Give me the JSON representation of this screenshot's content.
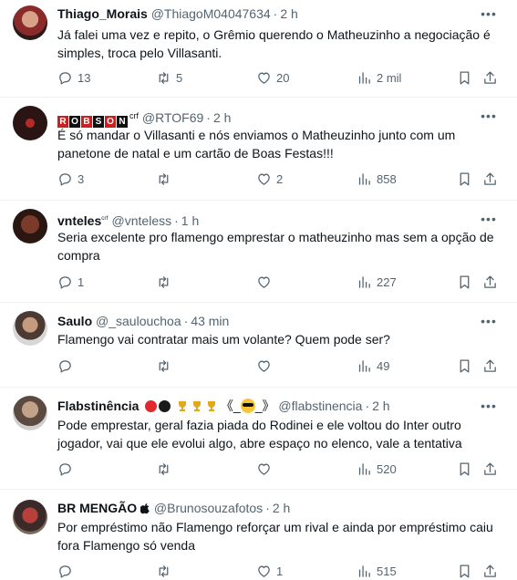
{
  "colors": {
    "text": "#0f1419",
    "muted": "#536471",
    "divider": "#eff3f4"
  },
  "tweets": [
    {
      "name": "Thiago_Morais",
      "handle": "@ThiagoM04047634",
      "time": "2 h",
      "text": "Já falei uma vez e repito, o Grêmio querendo o Matheuzinho a negociação é simples, troca pelo Villasanti.",
      "replies": "13",
      "retweets": "5",
      "likes": "20",
      "views": "2 mil"
    },
    {
      "name_letters": [
        "R",
        "O",
        "B",
        "S",
        "O",
        "N"
      ],
      "name_suffix": "crf",
      "handle": "@RTOF69",
      "time": "2 h",
      "text": "É só mandar o Villasanti e nós enviamos o Matheuzinho junto com um panetone de natal e um cartão de Boas Festas!!!",
      "replies": "3",
      "retweets": "",
      "likes": "2",
      "views": "858"
    },
    {
      "name": "vnteles",
      "name_suffix": "ᶜʳᶠ",
      "handle": "@vnteless",
      "time": "1 h",
      "text": "Seria excelente pro flamengo emprestar o matheuzinho mas sem a opção de compra",
      "replies": "1",
      "retweets": "",
      "likes": "",
      "views": "227"
    },
    {
      "name": "Saulo",
      "handle": "@_saulouchoa",
      "time": "43 min",
      "text": "Flamengo vai contratar mais um volante? Quem pode ser?",
      "replies": "",
      "retweets": "",
      "likes": "",
      "views": "49"
    },
    {
      "name": "Flabstinência",
      "name_extra": "《_",
      "name_extra2": "_》",
      "handle": "@flabstinencia",
      "time": "2 h",
      "text": "Pode emprestar, geral fazia piada do Rodinei e ele voltou do Inter outro jogador, vai que ele evolui algo, abre espaço no elenco, vale a tentativa",
      "replies": "",
      "retweets": "",
      "likes": "",
      "views": "520"
    },
    {
      "name": "BR MENGÃO",
      "handle": "@Brunosouzafotos",
      "time": "2 h",
      "text": "Por empréstimo não Flamengo reforçar um rival e ainda por empréstimo caiu fora Flamengo só venda",
      "replies": "",
      "retweets": "",
      "likes": "1",
      "views": "515"
    }
  ],
  "more_label": "•••",
  "separator": "·"
}
